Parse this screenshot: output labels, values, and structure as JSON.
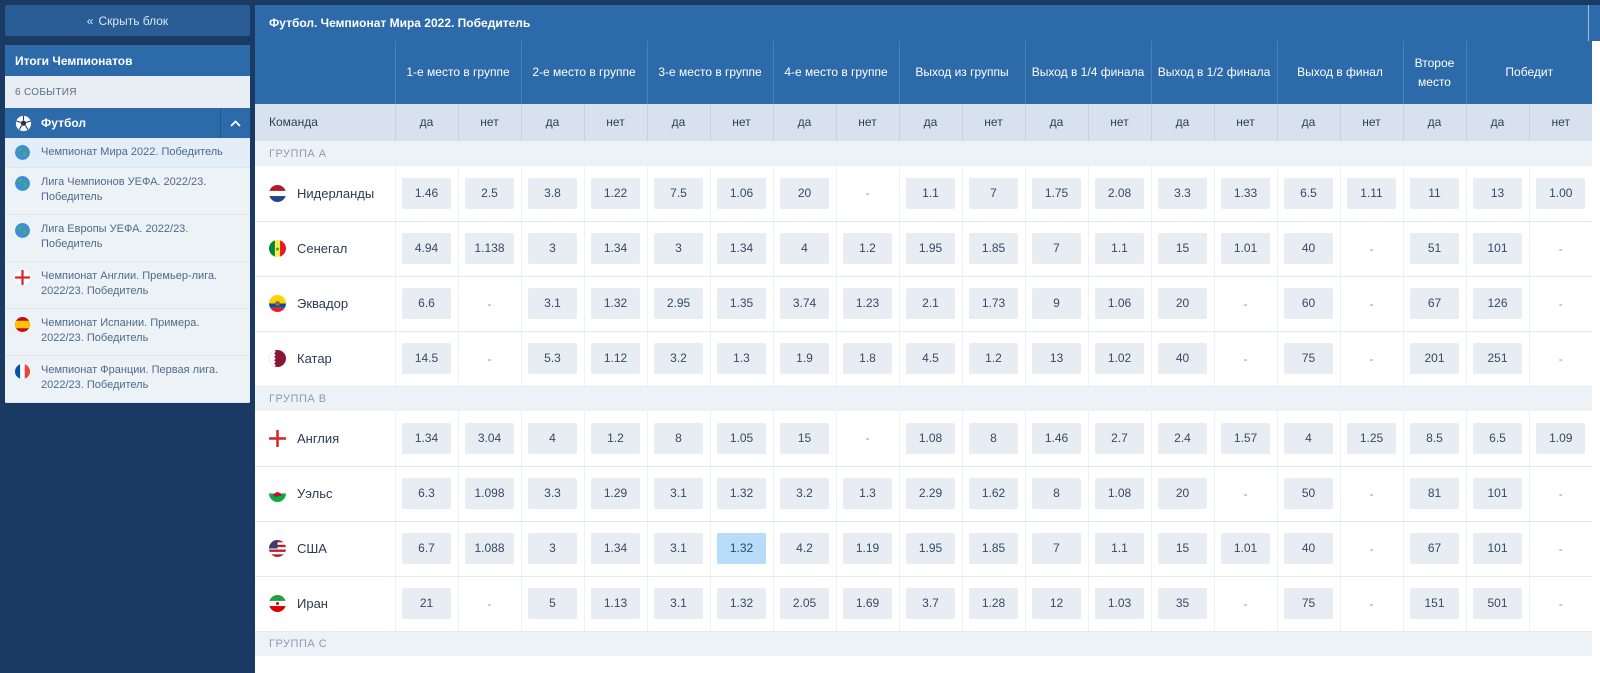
{
  "sidebar": {
    "hide_label": "Скрыть блок",
    "panel_title": "Итоги Чемпионатов",
    "events_count": "6 СОБЫТИЯ",
    "sport": "Футбол",
    "competitions": [
      {
        "label": "Чемпионат Мира 2022. Победитель",
        "flag": "world"
      },
      {
        "label": "Лига Чемпионов УЕФА. 2022/23. Победитель",
        "flag": "world"
      },
      {
        "label": "Лига Европы УЕФА. 2022/23. Победитель",
        "flag": "world"
      },
      {
        "label": "Чемпионат Англии. Премьер-лига. 2022/23. Победитель",
        "flag": "england"
      },
      {
        "label": "Чемпионат Испании. Примера. 2022/23. Победитель",
        "flag": "spain"
      },
      {
        "label": "Чемпионат Франции. Первая лига. 2022/23. Победитель",
        "flag": "france"
      }
    ]
  },
  "main": {
    "title": "Футбол. Чемпионат Мира 2022. Победитель",
    "team_header": "Команда",
    "columns": [
      {
        "label": "1-е место в группе",
        "split": true
      },
      {
        "label": "2-е место в группе",
        "split": true
      },
      {
        "label": "3-е место в группе",
        "split": true
      },
      {
        "label": "4-е место в группе",
        "split": true
      },
      {
        "label": "Выход из группы",
        "split": true
      },
      {
        "label": "Выход в 1/4 финала",
        "split": true
      },
      {
        "label": "Выход в 1/2 финала",
        "split": true
      },
      {
        "label": "Выход в финал",
        "split": true
      },
      {
        "label": "Второе место",
        "split": false
      },
      {
        "label": "Победит",
        "split": true
      }
    ],
    "yes": "да",
    "no": "нет",
    "groups": [
      {
        "label": "ГРУППА A",
        "teams": [
          {
            "name": "Нидерланды",
            "flag": "nl",
            "odds": [
              "1.46",
              "2.5",
              "3.8",
              "1.22",
              "7.5",
              "1.06",
              "20",
              "-",
              "1.1",
              "7",
              "1.75",
              "2.08",
              "3.3",
              "1.33",
              "6.5",
              "1.11",
              "11",
              "13",
              "1.00"
            ]
          },
          {
            "name": "Сенегал",
            "flag": "sn",
            "odds": [
              "4.94",
              "1.138",
              "3",
              "1.34",
              "3",
              "1.34",
              "4",
              "1.2",
              "1.95",
              "1.85",
              "7",
              "1.1",
              "15",
              "1.01",
              "40",
              "-",
              "51",
              "101",
              "-"
            ]
          },
          {
            "name": "Эквадор",
            "flag": "ec",
            "odds": [
              "6.6",
              "-",
              "3.1",
              "1.32",
              "2.95",
              "1.35",
              "3.74",
              "1.23",
              "2.1",
              "1.73",
              "9",
              "1.06",
              "20",
              "-",
              "60",
              "-",
              "67",
              "126",
              "-"
            ]
          },
          {
            "name": "Катар",
            "flag": "qa",
            "odds": [
              "14.5",
              "-",
              "5.3",
              "1.12",
              "3.2",
              "1.3",
              "1.9",
              "1.8",
              "4.5",
              "1.2",
              "13",
              "1.02",
              "40",
              "-",
              "75",
              "-",
              "201",
              "251",
              "-"
            ]
          }
        ]
      },
      {
        "label": "ГРУППА B",
        "teams": [
          {
            "name": "Англия",
            "flag": "en",
            "odds": [
              "1.34",
              "3.04",
              "4",
              "1.2",
              "8",
              "1.05",
              "15",
              "-",
              "1.08",
              "8",
              "1.46",
              "2.7",
              "2.4",
              "1.57",
              "4",
              "1.25",
              "8.5",
              "6.5",
              "1.09"
            ]
          },
          {
            "name": "Уэльс",
            "flag": "wa",
            "odds": [
              "6.3",
              "1.098",
              "3.3",
              "1.29",
              "3.1",
              "1.32",
              "3.2",
              "1.3",
              "2.29",
              "1.62",
              "8",
              "1.08",
              "20",
              "-",
              "50",
              "-",
              "81",
              "101",
              "-"
            ]
          },
          {
            "name": "США",
            "flag": "us",
            "odds": [
              "6.7",
              "1.088",
              "3",
              "1.34",
              "3.1",
              "1.32",
              "4.2",
              "1.19",
              "1.95",
              "1.85",
              "7",
              "1.1",
              "15",
              "1.01",
              "40",
              "-",
              "67",
              "101",
              "-"
            ],
            "selected_index": 5
          },
          {
            "name": "Иран",
            "flag": "ir",
            "odds": [
              "21",
              "-",
              "5",
              "1.13",
              "3.1",
              "1.32",
              "2.05",
              "1.69",
              "3.7",
              "1.28",
              "12",
              "1.03",
              "35",
              "-",
              "75",
              "-",
              "151",
              "501",
              "-"
            ]
          }
        ]
      },
      {
        "label": "ГРУППА C",
        "teams": []
      }
    ]
  }
}
